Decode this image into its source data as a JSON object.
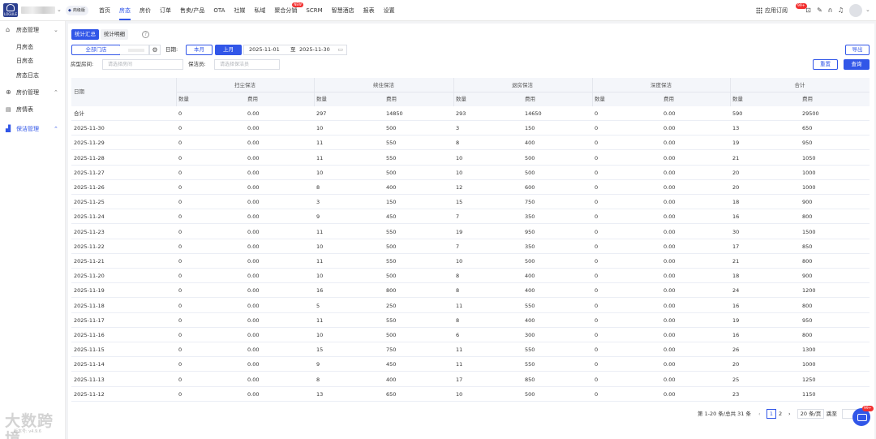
{
  "header": {
    "logo_text": "LOGULE",
    "version_badge": "商级版",
    "nav": [
      {
        "label": "首页",
        "active": false
      },
      {
        "label": "房态",
        "active": true
      },
      {
        "label": "房价",
        "active": false
      },
      {
        "label": "订单",
        "active": false
      },
      {
        "label": "售卖/产品",
        "active": false
      },
      {
        "label": "OTA",
        "active": false
      },
      {
        "label": "社媒",
        "active": false
      },
      {
        "label": "私域",
        "active": false
      },
      {
        "label": "聚合分销",
        "active": false,
        "badge": "NEW"
      },
      {
        "label": "SCRM",
        "active": false
      },
      {
        "label": "智慧酒店",
        "active": false
      },
      {
        "label": "报表",
        "active": false
      },
      {
        "label": "设置",
        "active": false
      }
    ],
    "app_subscribe": "应用订阅",
    "notify_badge": "99+"
  },
  "sidebar": {
    "groups": [
      {
        "icon": "house-icon",
        "label": "房态管理",
        "arrow": "⌄",
        "items": [
          "月房态",
          "日房态",
          "房态日志"
        ]
      },
      {
        "icon": "price-icon",
        "label": "房价管理",
        "arrow": "⌃",
        "items": [
          "房情表"
        ]
      },
      {
        "icon": "clean-icon",
        "label": "保洁管理",
        "arrow": "⌃",
        "items": [],
        "active": true
      }
    ],
    "watermark": "大数跨境",
    "version": "版本号: v4.9.6"
  },
  "toolbar": {
    "tabs": [
      {
        "label": "统计汇总",
        "active": true
      },
      {
        "label": "统计明细",
        "active": false
      }
    ],
    "help_icon": "?",
    "all_stores": "全部门店",
    "date_label": "日期:",
    "this_month": "本月",
    "last_month": "上月",
    "date_from": "2025-11-01",
    "date_sep": "至",
    "date_to": "2025-11-30",
    "room_label": "房型房间:",
    "room_placeholder": "请选择房间",
    "cleaner_label": "保洁员:",
    "cleaner_placeholder": "请选择保洁员",
    "export": "导出",
    "reset": "重置",
    "query": "查询"
  },
  "table": {
    "date_header": "日期",
    "groups": [
      "扫尘保洁",
      "续住保洁",
      "退房保洁",
      "深度保洁",
      "合计"
    ],
    "sub_headers": [
      "数量",
      "费用"
    ],
    "rows": [
      {
        "date": "合计",
        "v": [
          "0",
          "0.00",
          "297",
          "14850",
          "293",
          "14650",
          "0",
          "0.00",
          "590",
          "29500"
        ]
      },
      {
        "date": "2025-11-30",
        "v": [
          "0",
          "0.00",
          "10",
          "500",
          "3",
          "150",
          "0",
          "0.00",
          "13",
          "650"
        ]
      },
      {
        "date": "2025-11-29",
        "v": [
          "0",
          "0.00",
          "11",
          "550",
          "8",
          "400",
          "0",
          "0.00",
          "19",
          "950"
        ]
      },
      {
        "date": "2025-11-28",
        "v": [
          "0",
          "0.00",
          "11",
          "550",
          "10",
          "500",
          "0",
          "0.00",
          "21",
          "1050"
        ]
      },
      {
        "date": "2025-11-27",
        "v": [
          "0",
          "0.00",
          "10",
          "500",
          "10",
          "500",
          "0",
          "0.00",
          "20",
          "1000"
        ]
      },
      {
        "date": "2025-11-26",
        "v": [
          "0",
          "0.00",
          "8",
          "400",
          "12",
          "600",
          "0",
          "0.00",
          "20",
          "1000"
        ]
      },
      {
        "date": "2025-11-25",
        "v": [
          "0",
          "0.00",
          "3",
          "150",
          "15",
          "750",
          "0",
          "0.00",
          "18",
          "900"
        ]
      },
      {
        "date": "2025-11-24",
        "v": [
          "0",
          "0.00",
          "9",
          "450",
          "7",
          "350",
          "0",
          "0.00",
          "16",
          "800"
        ]
      },
      {
        "date": "2025-11-23",
        "v": [
          "0",
          "0.00",
          "11",
          "550",
          "19",
          "950",
          "0",
          "0.00",
          "30",
          "1500"
        ]
      },
      {
        "date": "2025-11-22",
        "v": [
          "0",
          "0.00",
          "10",
          "500",
          "7",
          "350",
          "0",
          "0.00",
          "17",
          "850"
        ]
      },
      {
        "date": "2025-11-21",
        "v": [
          "0",
          "0.00",
          "11",
          "550",
          "10",
          "500",
          "0",
          "0.00",
          "21",
          "800"
        ]
      },
      {
        "date": "2025-11-20",
        "v": [
          "0",
          "0.00",
          "10",
          "500",
          "8",
          "400",
          "0",
          "0.00",
          "18",
          "900"
        ]
      },
      {
        "date": "2025-11-19",
        "v": [
          "0",
          "0.00",
          "16",
          "800",
          "8",
          "400",
          "0",
          "0.00",
          "24",
          "1200"
        ]
      },
      {
        "date": "2025-11-18",
        "v": [
          "0",
          "0.00",
          "5",
          "250",
          "11",
          "550",
          "0",
          "0.00",
          "16",
          "800"
        ]
      },
      {
        "date": "2025-11-17",
        "v": [
          "0",
          "0.00",
          "11",
          "550",
          "8",
          "400",
          "0",
          "0.00",
          "19",
          "950"
        ]
      },
      {
        "date": "2025-11-16",
        "v": [
          "0",
          "0.00",
          "10",
          "500",
          "6",
          "300",
          "0",
          "0.00",
          "16",
          "800"
        ]
      },
      {
        "date": "2025-11-15",
        "v": [
          "0",
          "0.00",
          "15",
          "750",
          "11",
          "550",
          "0",
          "0.00",
          "26",
          "1300"
        ]
      },
      {
        "date": "2025-11-14",
        "v": [
          "0",
          "0.00",
          "9",
          "450",
          "11",
          "550",
          "0",
          "0.00",
          "20",
          "1000"
        ]
      },
      {
        "date": "2025-11-13",
        "v": [
          "0",
          "0.00",
          "8",
          "400",
          "17",
          "850",
          "0",
          "0.00",
          "25",
          "1250"
        ]
      },
      {
        "date": "2025-11-12",
        "v": [
          "0",
          "0.00",
          "13",
          "650",
          "10",
          "500",
          "0",
          "0.00",
          "23",
          "1150"
        ]
      }
    ]
  },
  "pagination": {
    "summary": "第 1-20 条/总共 31 条",
    "prev": "‹",
    "pages": [
      "1",
      "2"
    ],
    "current": "1",
    "next": "›",
    "page_size": "20 条/页",
    "jump_label": "跳至"
  },
  "chat_badge": "99+",
  "colors": {
    "accent": "#3156e8",
    "badge": "#f23030"
  }
}
